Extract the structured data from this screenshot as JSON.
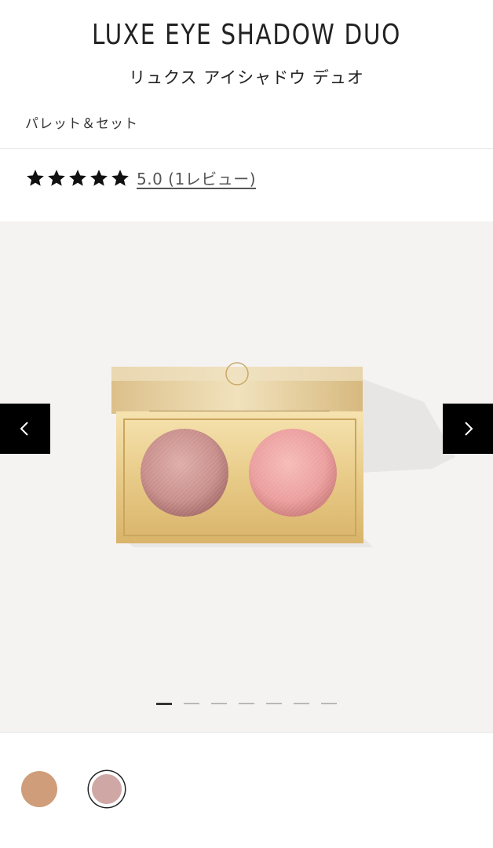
{
  "product": {
    "title": "LUXE EYE SHADOW DUO",
    "subtitle": "リュクス アイシャドウ デュオ",
    "category": "パレット＆セット"
  },
  "rating": {
    "stars": 5,
    "link_text": "5.0 (1レビュー)"
  },
  "gallery": {
    "prev_icon": "chevron-left-icon",
    "next_icon": "chevron-right-icon",
    "image_count": 7,
    "active_index": 0
  },
  "swatches": [
    {
      "color": "#cf9d79",
      "selected": false
    },
    {
      "color": "#cfa8a6",
      "selected": true
    }
  ],
  "colors": {
    "star": "#111111",
    "nav_bg": "#000000",
    "gallery_bg": "#f5f3f2",
    "gold": "#e9cd8c",
    "pan_left": "#c88f8c",
    "pan_right": "#eb9f9e"
  }
}
